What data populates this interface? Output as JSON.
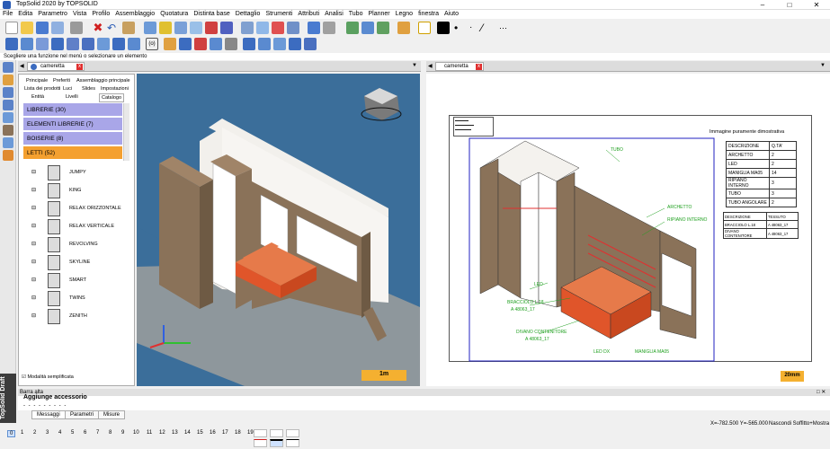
{
  "title": "TopSolid 2020 by TOPSOLID",
  "menu": [
    "File",
    "Edita",
    "Parametro",
    "Vista",
    "Profilo",
    "Assemblaggio",
    "Quotatura",
    "Distinta base",
    "Dettaglio",
    "Strumenti",
    "Attributi",
    "Analisi",
    "Tubo",
    "Planner",
    "Legno",
    "finestra",
    "Aiuto"
  ],
  "prompt": "Scegliere una funzione nel menù o selezionare un elemento",
  "doc_left": "cameretta",
  "doc_right": "cameretta",
  "tabs_row1": [
    "Principale",
    "Preferiti",
    "Assemblaggio principale"
  ],
  "tabs_row2": [
    "Lista dei prodotti",
    "Luci",
    "Slides",
    "Impostazioni"
  ],
  "tabs_row3": [
    "Entità",
    "Livelli",
    "Catalogo"
  ],
  "categories": [
    {
      "label": "LIBRERIE (30)"
    },
    {
      "label": "ELEMENTI LIBRERIE (7)"
    },
    {
      "label": "BOISERIE (8)"
    },
    {
      "label": "LETTI (52)"
    }
  ],
  "items": [
    "JUMPY",
    "KING",
    "RELAX ORIZZONTALE",
    "RELAX VERTICALE",
    "REVOLVING",
    "SKYLINE",
    "SMART",
    "TWINS",
    "ZENITH"
  ],
  "modalita": "Modalità semplificata",
  "view1_scale": "1m",
  "view2_scale": "20mm",
  "drawing": {
    "title": "Immagine puramente dimostrativa",
    "table1_head": [
      "DESCRIZIONE",
      "Q.TA'"
    ],
    "table1_rows": [
      [
        "ARCHETTO",
        "2"
      ],
      [
        "LED",
        "2"
      ],
      [
        "MANIGLIA MA05",
        "14"
      ],
      [
        "RIPIANO INTERNO",
        "3"
      ],
      [
        "TUBO",
        "3"
      ],
      [
        "TUBO ANGOLARE",
        "2"
      ]
    ],
    "table2_head": [
      "DESCRIZIONE",
      "TESSUTO"
    ],
    "table2_rows": [
      [
        "BRACCIOLO L.18",
        "A 48063_17"
      ],
      [
        "DIVANO CONTENITORE",
        "A 48063_17"
      ]
    ],
    "labels": [
      "TUBO",
      "ARCHETTO",
      "RIPIANO INTERNO",
      "LED",
      "BRACCIOLO L.18",
      "A 48063_17",
      "DIVANO CONTENITORE",
      "A 48063_17",
      "LED DX",
      "MANIGLIA MA05"
    ]
  },
  "bottom_bar": "Barra alta",
  "bottom_text": "Aggiunge accessorio",
  "bottom_tabs": [
    "Messaggi",
    "Parametri",
    "Misure"
  ],
  "brand_vertical": "TopSolid Draft",
  "status": {
    "coords": "X=-782.500   Y=-565.000",
    "mode": "Nascondi Soffitto+Mostra"
  },
  "layers": [
    "0",
    "1",
    "2",
    "3",
    "4",
    "5",
    "6",
    "7",
    "8",
    "9",
    "10",
    "11",
    "12",
    "13",
    "14",
    "15",
    "16",
    "17",
    "18",
    "19"
  ],
  "colors": {
    "wood": "#8a7259",
    "sofa": "#e0552a",
    "view_bg": "#3b6e9a",
    "selected_cat": "#f4a030",
    "cat_bg": "#a9a6e8"
  }
}
